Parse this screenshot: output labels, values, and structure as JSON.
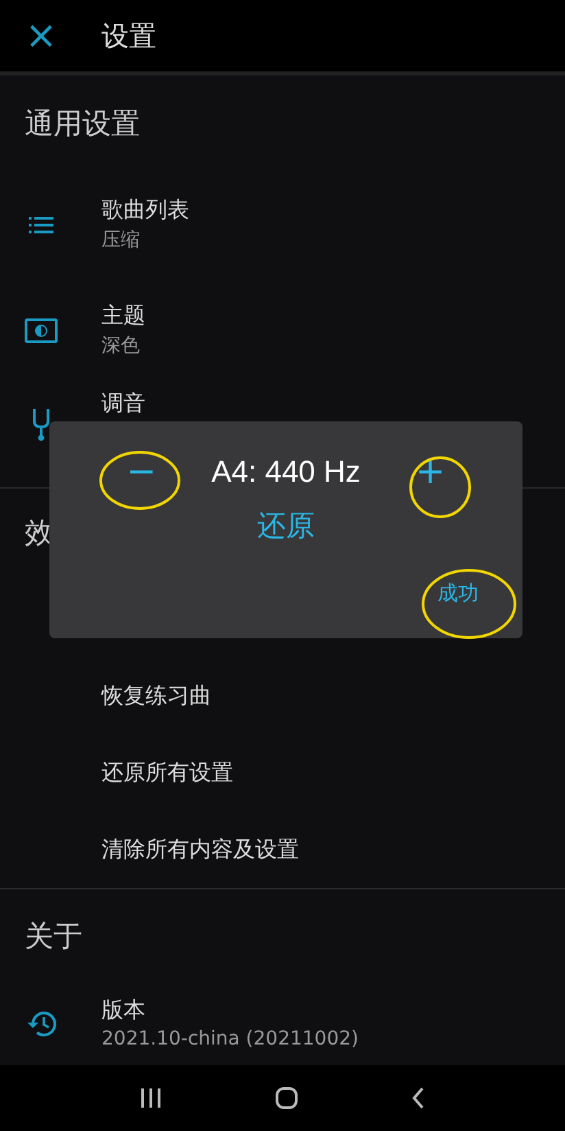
{
  "header": {
    "close": "×",
    "title": "设置"
  },
  "sections": [
    {
      "title": "通用设置",
      "items": [
        {
          "kind": "list",
          "title": "歌曲列表",
          "subtitle": "压缩"
        },
        {
          "kind": "theme",
          "title": "主题",
          "subtitle": "深色"
        },
        {
          "kind": "fork",
          "title": "调音"
        }
      ]
    },
    {
      "title": "效",
      "items": [
        {
          "kind": "plain",
          "title": "恢复练习曲"
        },
        {
          "kind": "plain",
          "title": "还原所有设置"
        },
        {
          "kind": "plain",
          "title": "清除所有内容及设置"
        }
      ]
    },
    {
      "title": "关于",
      "items": [
        {
          "kind": "history",
          "title": "版本",
          "subtitle": "2021.10-china (20211002)"
        }
      ]
    }
  ],
  "dialog": {
    "minus": "−",
    "value": "A4: 440 Hz",
    "plus": "+",
    "reset": "还原",
    "ok": "成功"
  }
}
